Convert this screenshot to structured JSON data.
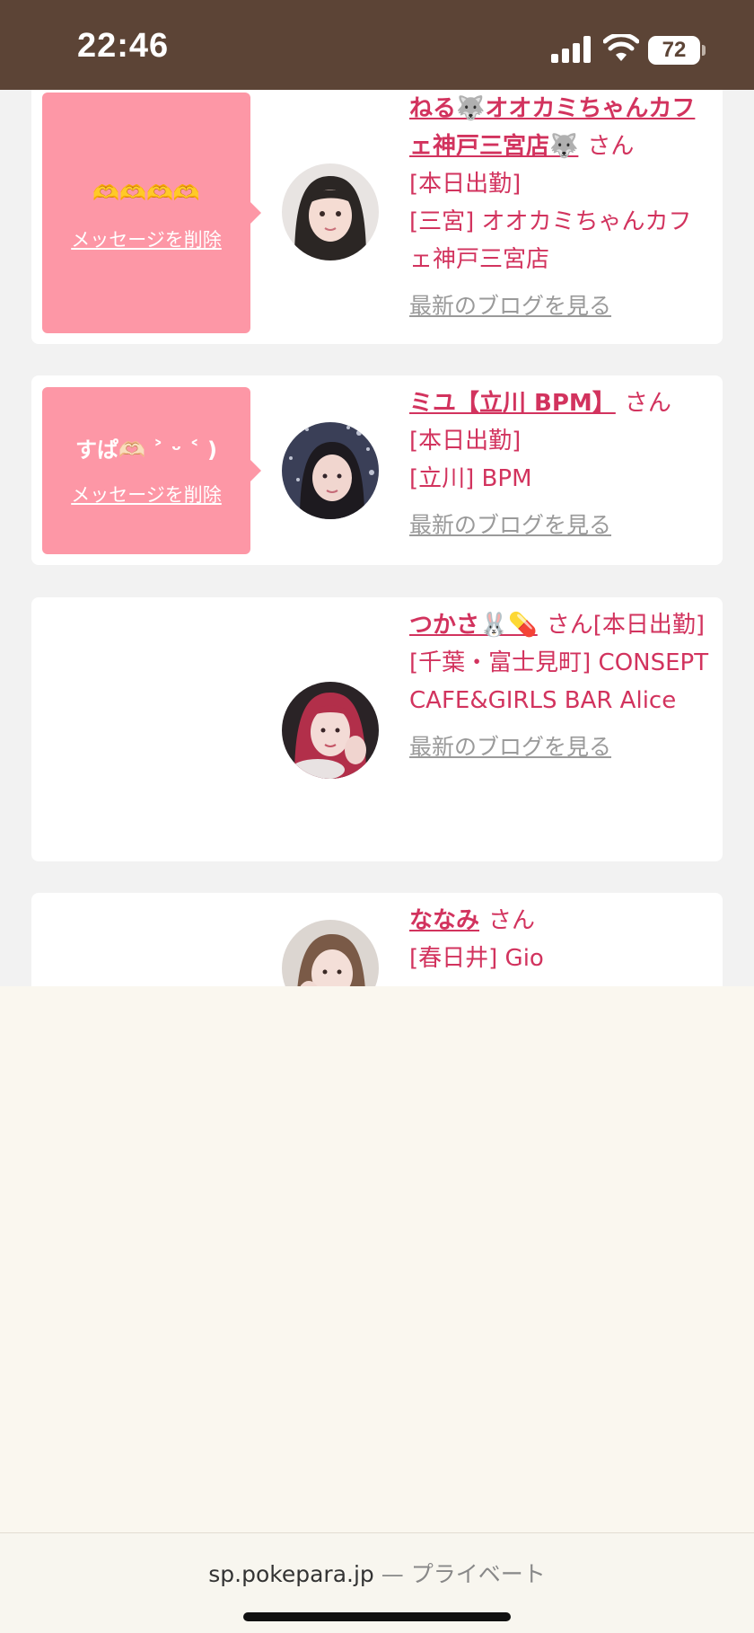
{
  "status_bar": {
    "time": "22:46",
    "battery": "72",
    "icons": [
      "cellular-signal-icon",
      "wifi-icon",
      "battery-icon"
    ]
  },
  "colors": {
    "status_bar_bg": "#5c4436",
    "accent_pink": "#d2335e",
    "bubble_pink": "#fd97a6",
    "content_bg": "#f2f2f2"
  },
  "cards": [
    {
      "bubble_message": "🫶🫶🫶🫶",
      "delete_label": "メッセージを削除",
      "name": "ねる🐺オオカミちゃんカフェ神戸三宮店🐺",
      "suffix": "さん",
      "status": "[本日出勤]",
      "shop": "[三宮] オオカミちゃんカフェ神戸三宮店",
      "blog_link": "最新のブログを見る"
    },
    {
      "bubble_message": "すぱ🫶🏻 ˃ ᵕ ˂ )",
      "delete_label": "メッセージを削除",
      "name": "ミユ【立川 BPM】",
      "suffix": "さん",
      "status": "[本日出勤]",
      "shop": "[立川] BPM",
      "blog_link": "最新のブログを見る"
    },
    {
      "name": "つかさ🐰💊",
      "suffix": "さん",
      "status": "[本日出勤]",
      "shop": "[千葉・富士見町] CONSEPT CAFE&GIRLS BAR Alice",
      "blog_link": "最新のブログを見る"
    },
    {
      "name": "ななみ",
      "suffix": "さん",
      "shop": "[春日井] Gio"
    }
  ],
  "browser_bar": {
    "domain": "sp.pokepara.jp",
    "separator": "—",
    "mode": "プライベート"
  }
}
